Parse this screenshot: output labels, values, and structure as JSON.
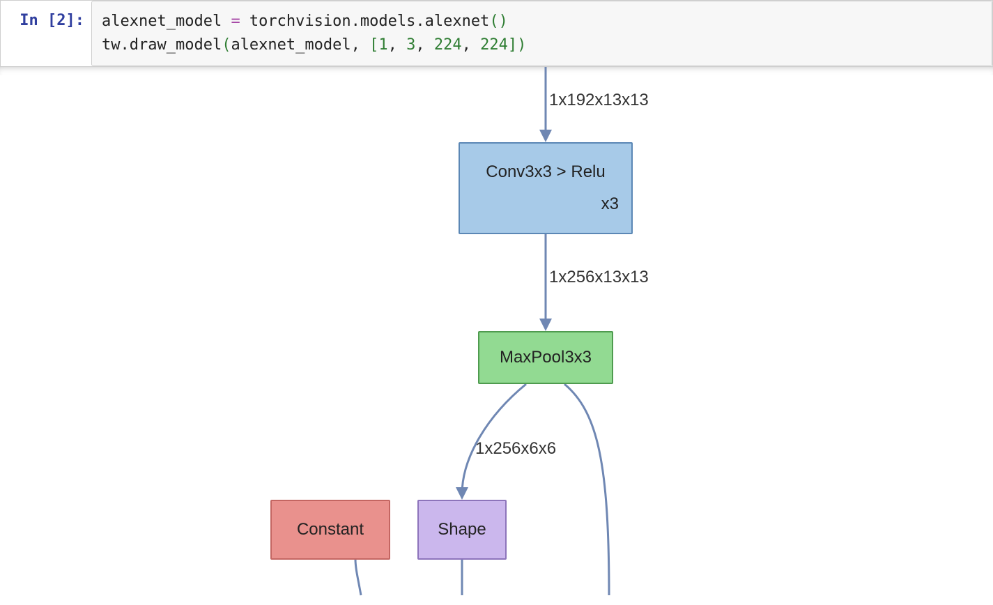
{
  "cell": {
    "prompt": "In [2]:",
    "code": {
      "line1": {
        "t1": "alexnet_model ",
        "op": "=",
        "t2": " torchvision.models.alexnet",
        "p1": "(",
        "p2": ")"
      },
      "line2": {
        "t1": "tw.draw_model",
        "p1": "(",
        "t2": "alexnet_model, ",
        "p2": "[",
        "n1": "1",
        "c1": ", ",
        "n2": "3",
        "c2": ", ",
        "n3": "224",
        "c3": ", ",
        "n4": "224",
        "p3": "]",
        "p4": ")"
      }
    }
  },
  "graph": {
    "nodes": {
      "conv": {
        "label": "Conv3x3 > Relu",
        "sub": "x3"
      },
      "maxpool": {
        "label": "MaxPool3x3"
      },
      "shape": {
        "label": "Shape"
      },
      "constant": {
        "label": "Constant"
      }
    },
    "edges": {
      "e1": {
        "label": "1x192x13x13"
      },
      "e2": {
        "label": "1x256x13x13"
      },
      "e3": {
        "label": "1x256x6x6"
      }
    },
    "colors": {
      "blue": "#a7cae8",
      "green": "#92da92",
      "purple": "#cbb7ed",
      "red": "#e9918d",
      "edge": "#6f87b3"
    }
  }
}
